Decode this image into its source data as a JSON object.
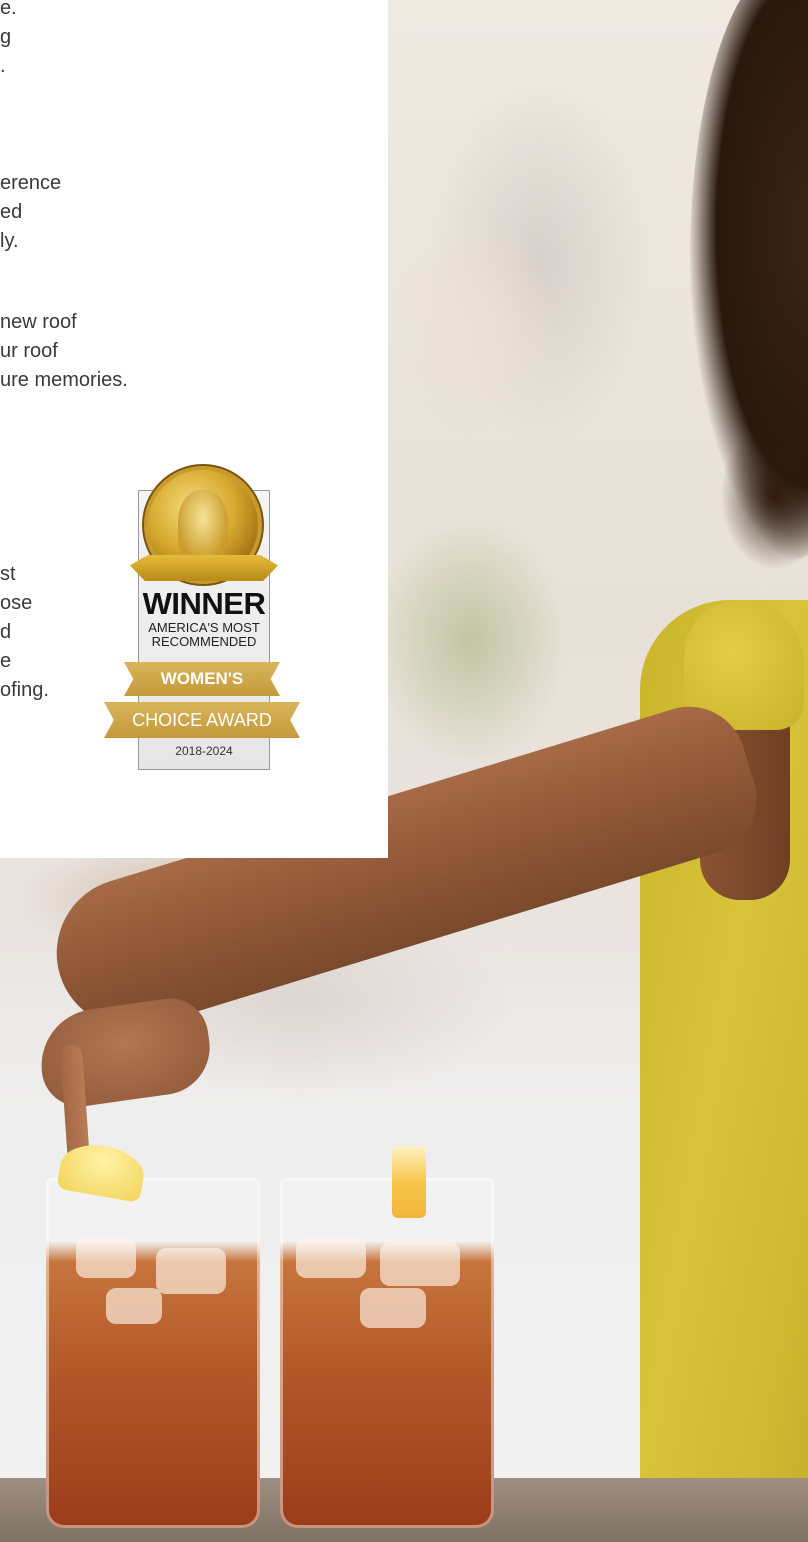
{
  "content": {
    "paragraphs": [
      "e.\ng\n.",
      "erence\ned\nly.",
      "new roof\nur roof\nure memories.",
      "st\nose\nd\ne\nofing."
    ]
  },
  "award": {
    "winner": "WINNER",
    "line1": "AMERICA'S MOST",
    "line2": "RECOMMENDED",
    "ribbon1": "WOMEN'S",
    "ribbon2": "CHOICE AWARD",
    "years": "2018-2024"
  }
}
